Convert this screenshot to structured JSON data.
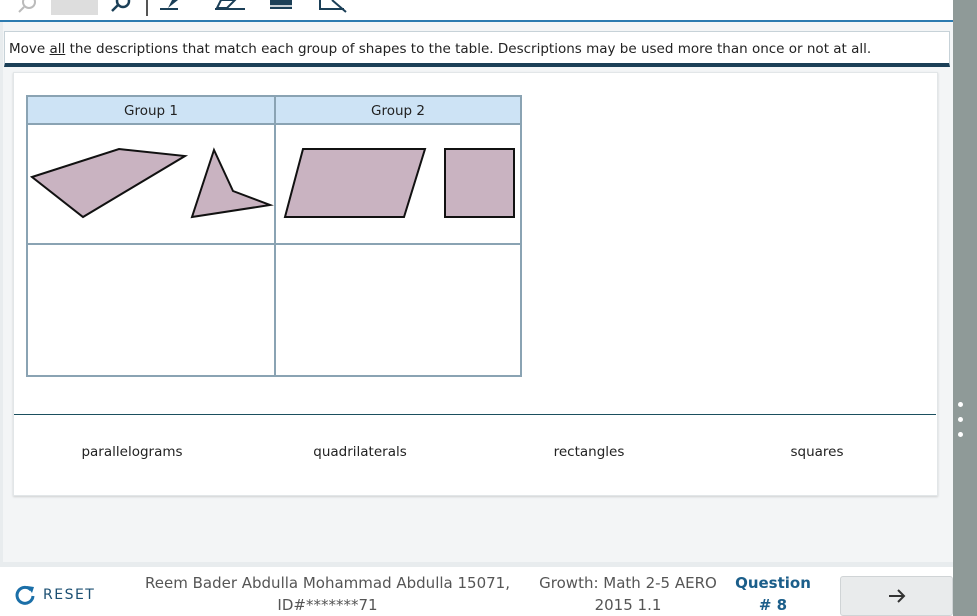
{
  "instructions": {
    "prefix": "Move ",
    "emphasis": "all",
    "suffix": " the descriptions that match each group of shapes to the table. Descriptions may be used more than once or not at all."
  },
  "table": {
    "headers": [
      "Group 1",
      "Group 2"
    ],
    "group1_shapes": [
      "quadrilateral-icon",
      "concave-quadrilateral-icon"
    ],
    "group2_shapes": [
      "parallelogram-icon",
      "square-icon"
    ]
  },
  "tray": {
    "items": [
      "parallelograms",
      "quadrilaterals",
      "rectangles",
      "squares"
    ]
  },
  "footer": {
    "reset_label": "RESET",
    "student_line1": "Reem Bader Abdulla Mohammad Abdulla 15071,",
    "student_line2": "ID#*******71",
    "test_line1": "Growth: Math 2-5 AERO",
    "test_line2": "2015 1.1",
    "question_line1": "Question",
    "question_line2": "# 8"
  },
  "colors": {
    "shape_fill": "#c9b3c1",
    "header_fill": "#cde3f5",
    "accent": "#1b5e8a"
  }
}
